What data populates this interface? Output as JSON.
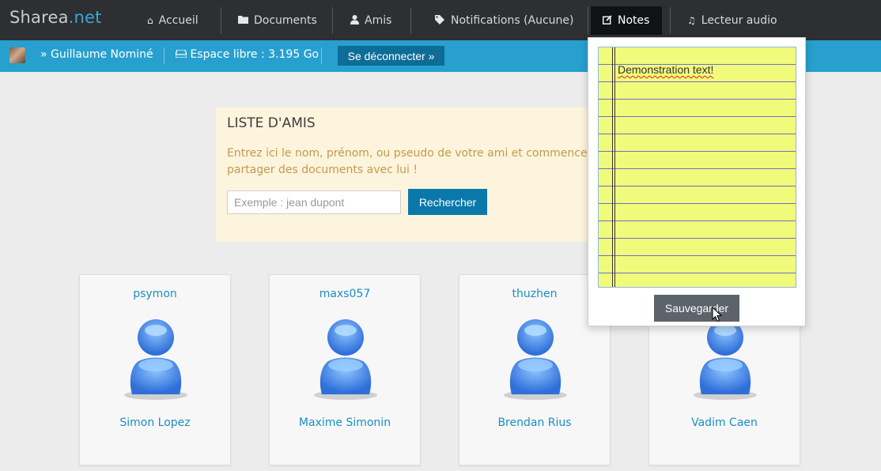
{
  "navbar": {
    "brand_main": "Sharea",
    "brand_suffix": ".net",
    "items": [
      {
        "label": "Accueil",
        "icon": "home-icon"
      },
      {
        "label": "Documents",
        "icon": "folder-icon"
      },
      {
        "label": "Amis",
        "icon": "user-icon"
      },
      {
        "label": "Notifications (Aucune)",
        "icon": "tags-icon"
      },
      {
        "label": "Notes",
        "icon": "edit-icon",
        "active": true
      },
      {
        "label": "Lecteur audio",
        "icon": "music-icon"
      }
    ]
  },
  "subbar": {
    "user": "» Guillaume Nominé",
    "storage": "Espace libre : 3.195 Go",
    "storage_icon": "hdd-icon",
    "logout": "Se déconnecter »"
  },
  "friends": {
    "title": "LISTE D'AMIS",
    "description": "Entrez ici le nom, prénom, ou pseudo de votre ami et commencez à partager des documents avec lui !",
    "search_placeholder": "Exemple : jean dupont",
    "search_button": "Rechercher",
    "list": [
      {
        "username": "psymon",
        "name": "Simon Lopez"
      },
      {
        "username": "maxs057",
        "name": "Maxime Simonin"
      },
      {
        "username": "thuzhen",
        "name": "Brendan Rius"
      },
      {
        "username": "",
        "name": "Vadim Caen"
      }
    ]
  },
  "notes": {
    "text": "Demonstration text!",
    "save_button": "Sauvegarder"
  },
  "colors": {
    "navbar": "#2d2f33",
    "subbar": "#27a0cf",
    "link": "#1a8fc2",
    "notepad": "#f1fb7b"
  }
}
